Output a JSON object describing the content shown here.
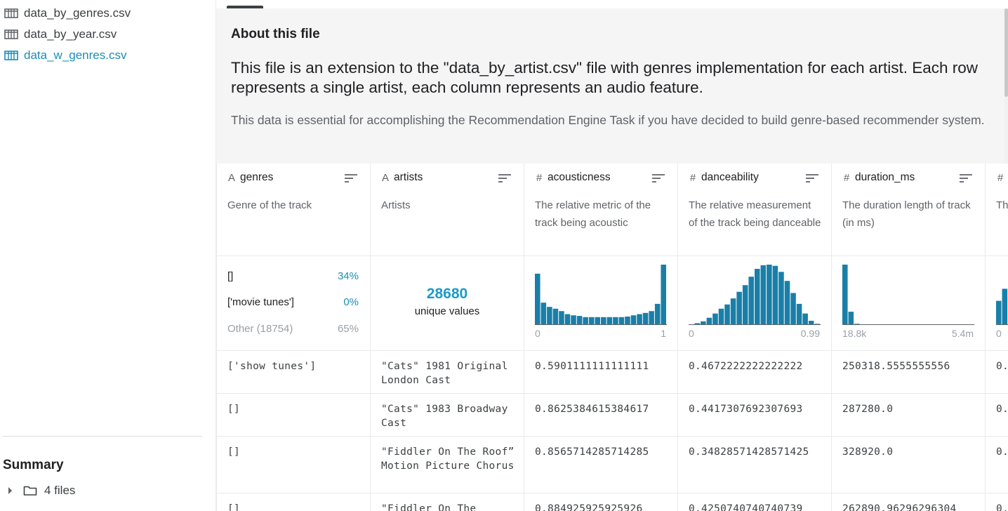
{
  "sidebar": {
    "files": [
      {
        "label": "data_by_genres.csv",
        "active": false
      },
      {
        "label": "data_by_year.csv",
        "active": false
      },
      {
        "label": "data_w_genres.csv",
        "active": true
      }
    ],
    "summary_title": "Summary",
    "summary_files": "4 files"
  },
  "about": {
    "heading": "About this file",
    "bold_text": "This file is an extension to the \"data_by_artist.csv\" file with genres implementation for each artist. Each row represents a single artist, each column represents an audio feature.",
    "body_text": "This data is essential for accomplishing the Recommendation Engine Task if you have decided to build genre-based recommender system."
  },
  "columns": [
    {
      "name": "genres",
      "type_icon": "string-icon",
      "type_glyph": "A",
      "description": "Genre of the track",
      "stats": {
        "kind": "categorical",
        "rows": [
          {
            "label": "[]",
            "pct": "34%"
          },
          {
            "label": "['movie tunes']",
            "pct": "0%"
          },
          {
            "label": "Other (18754)",
            "pct": "65%"
          }
        ]
      },
      "cells": [
        "['show tunes']",
        "[]",
        "[]",
        "[]"
      ]
    },
    {
      "name": "artists",
      "type_icon": "string-icon",
      "type_glyph": "A",
      "description": "Artists",
      "stats": {
        "kind": "unique",
        "count": "28680",
        "label": "unique values"
      },
      "cells": [
        "\"Cats\" 1981 Original London Cast",
        "\"Cats\" 1983 Broadway Cast",
        "\"Fiddler On The Roof” Motion Picture Chorus",
        "\"Fiddler On The"
      ]
    },
    {
      "name": "acousticness",
      "type_icon": "numeric-icon",
      "type_glyph": "#",
      "description": "The relative metric of the track being acoustic",
      "stats": {
        "kind": "histogram",
        "min": "0",
        "max": "1",
        "bins": [
          0.85,
          0.37,
          0.3,
          0.27,
          0.23,
          0.18,
          0.16,
          0.15,
          0.13,
          0.13,
          0.13,
          0.13,
          0.13,
          0.13,
          0.13,
          0.14,
          0.16,
          0.18,
          0.2,
          0.23,
          0.35,
          1.0
        ]
      },
      "cells": [
        "0.5901111111111111",
        "0.8625384615384617",
        "0.8565714285714285",
        "0.884925925925926"
      ]
    },
    {
      "name": "danceability",
      "type_icon": "numeric-icon",
      "type_glyph": "#",
      "description": "The relative measurement of the track being danceable",
      "stats": {
        "kind": "histogram",
        "min": "0",
        "max": "0.99",
        "bins": [
          0.01,
          0.03,
          0.06,
          0.12,
          0.19,
          0.27,
          0.34,
          0.44,
          0.55,
          0.66,
          0.8,
          0.93,
          0.99,
          1.0,
          0.98,
          0.88,
          0.73,
          0.53,
          0.35,
          0.19,
          0.07,
          0.02
        ]
      },
      "cells": [
        "0.4672222222222222",
        "0.4417307692307693",
        "0.34828571428571425",
        "0.4250740740740739"
      ]
    },
    {
      "name": "duration_ms",
      "type_icon": "numeric-icon",
      "type_glyph": "#",
      "description": "The duration length of track (in ms)",
      "stats": {
        "kind": "histogram",
        "min": "18.8k",
        "max": "5.4m",
        "bins": [
          1.0,
          0.22,
          0.02,
          0.01,
          0.01,
          0.005,
          0.005,
          0.005,
          0.005,
          0.005,
          0.005,
          0.005,
          0.005,
          0.005,
          0.005,
          0.005,
          0.005,
          0.005,
          0.005,
          0.005,
          0.005,
          0.005
        ]
      },
      "cells": [
        "250318.5555555556",
        "287280.0",
        "328920.0",
        "262890.96296296304"
      ]
    },
    {
      "name": "Th",
      "type_icon": "numeric-icon",
      "type_glyph": "#",
      "description": "Th",
      "stats": {
        "kind": "histogram",
        "min": "0",
        "max": "",
        "bins": [
          0.4,
          0.6
        ]
      },
      "cells": [
        "0.",
        "0.",
        "0.",
        "0."
      ]
    }
  ],
  "colors": {
    "accent": "#1a8db5",
    "bar": "#1a7fa8",
    "muted": "#9aa0a6"
  }
}
